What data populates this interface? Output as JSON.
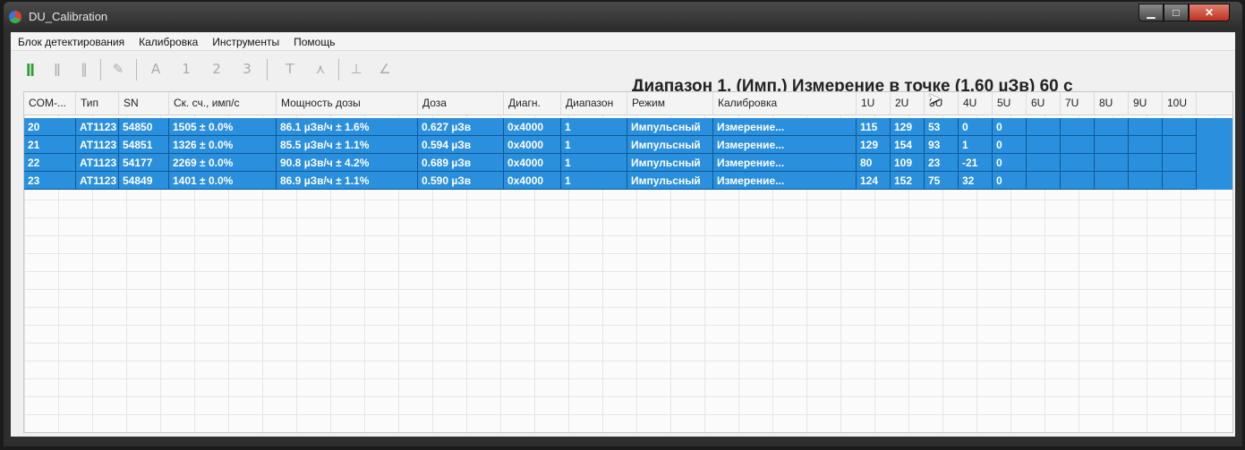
{
  "window": {
    "title": "DU_Calibration",
    "min_glyph": "▁",
    "max_glyph": "□",
    "close_glyph": "✕"
  },
  "menu": [
    "Блок детектирования",
    "Калибровка",
    "Инструменты",
    "Помощь"
  ],
  "toolbar": {
    "icons": [
      {
        "name": "detectors-connect-icon",
        "glyph": "ǁ",
        "active": true
      },
      {
        "name": "detectors-disconnect-icon",
        "glyph": "ǁ",
        "active": false
      },
      {
        "name": "detector-info-icon",
        "glyph": "‖",
        "active": false
      },
      {
        "name": "edit-graph-icon",
        "glyph": "✎",
        "active": false
      },
      {
        "name": "range-a-icon",
        "glyph": "A",
        "active": false
      },
      {
        "name": "range-1-icon",
        "glyph": "1",
        "active": false
      },
      {
        "name": "range-2-icon",
        "glyph": "2",
        "active": false
      },
      {
        "name": "range-3-icon",
        "glyph": "3",
        "active": false
      },
      {
        "name": "temperature-icon",
        "glyph": "T",
        "active": false
      },
      {
        "name": "pulse-icon",
        "glyph": "⋏",
        "active": false
      },
      {
        "name": "measure-icon",
        "glyph": "⊥",
        "active": false
      },
      {
        "name": "angle-icon",
        "glyph": "∠",
        "active": false
      }
    ]
  },
  "status_heading": "Диапазон 1. (Имп.) Измерение в точке (1.60 µЗв) 60 с",
  "table": {
    "columns": [
      "COM-...",
      "Тип",
      "SN",
      "Ск. сч., имп/с",
      "Мощность дозы",
      "Доза",
      "Диагн.",
      "Диапазон",
      "Режим",
      "Калибровка",
      "1U",
      "2U",
      "3U",
      "4U",
      "5U",
      "6U",
      "7U",
      "8U",
      "9U",
      "10U"
    ],
    "rows": [
      [
        "20",
        "AT1123",
        "54850",
        "1505 ± 0.0%",
        "86.1 µЗв/ч ± 1.6%",
        "0.627 µЗв",
        "0x4000",
        "1",
        "Импульсный",
        "Измерение...",
        "115",
        "129",
        "53",
        "0",
        "0",
        "",
        "",
        "",
        "",
        ""
      ],
      [
        "21",
        "AT1123",
        "54851",
        "1326 ± 0.0%",
        "85.5 µЗв/ч ± 1.1%",
        "0.594 µЗв",
        "0x4000",
        "1",
        "Импульсный",
        "Измерение...",
        "129",
        "154",
        "93",
        "1",
        "0",
        "",
        "",
        "",
        "",
        ""
      ],
      [
        "22",
        "AT1123",
        "54177",
        "2269 ± 0.0%",
        "90.8 µЗв/ч ± 4.2%",
        "0.689 µЗв",
        "0x4000",
        "1",
        "Импульсный",
        "Измерение...",
        "80",
        "109",
        "23",
        "-21",
        "0",
        "",
        "",
        "",
        "",
        ""
      ],
      [
        "23",
        "AT1123",
        "54849",
        "1401 ± 0.0%",
        "86.9 µЗв/ч ± 1.1%",
        "0.590 µЗв",
        "0x4000",
        "1",
        "Импульсный",
        "Измерение...",
        "124",
        "152",
        "75",
        "32",
        "0",
        "",
        "",
        "",
        "",
        ""
      ]
    ]
  },
  "colors": {
    "selection": "#2a8fdc",
    "active_icon": "#2fa02f"
  }
}
